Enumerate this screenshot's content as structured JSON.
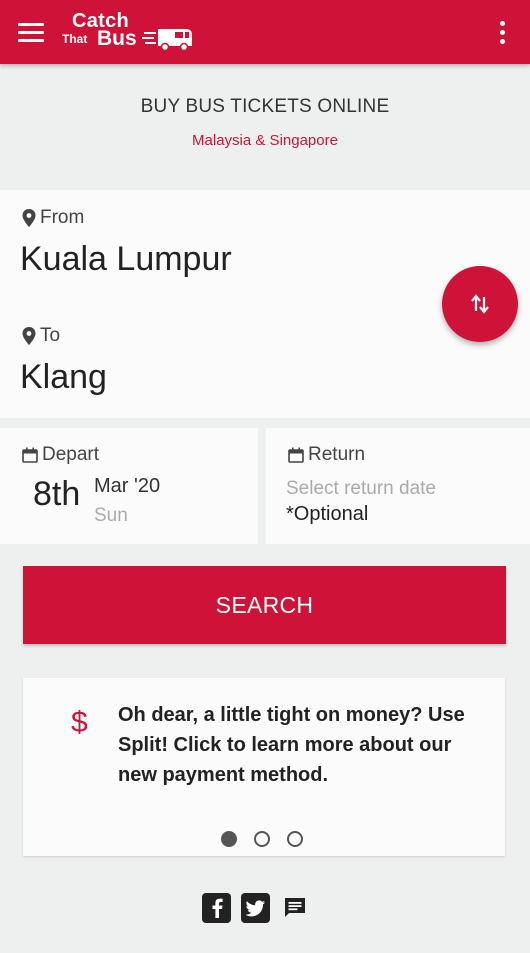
{
  "app": {
    "logo_line1": "Catch",
    "logo_line2a": "That",
    "logo_line2b": "Bus",
    "brand_color": "#cf1237"
  },
  "hero": {
    "headline": "BUY BUS TICKETS ONLINE",
    "subline": "Malaysia & Singapore"
  },
  "route": {
    "from_label": "From",
    "from_value": "Kuala Lumpur",
    "to_label": "To",
    "to_value": "Klang",
    "swap_icon": "swap-vertical-icon"
  },
  "depart": {
    "label": "Depart",
    "day": "8th",
    "month_year": "Mar '20",
    "weekday": "Sun"
  },
  "return": {
    "label": "Return",
    "placeholder": "Select return date",
    "note": "*Optional"
  },
  "search": {
    "label": "SEARCH"
  },
  "promo": {
    "icon": "$",
    "text": "Oh dear, a little tight on money? Use Split! Click to learn more about our new payment method.",
    "dots": [
      true,
      false,
      false
    ]
  },
  "footer": {
    "icons": [
      "facebook-icon",
      "twitter-icon",
      "message-icon"
    ]
  }
}
